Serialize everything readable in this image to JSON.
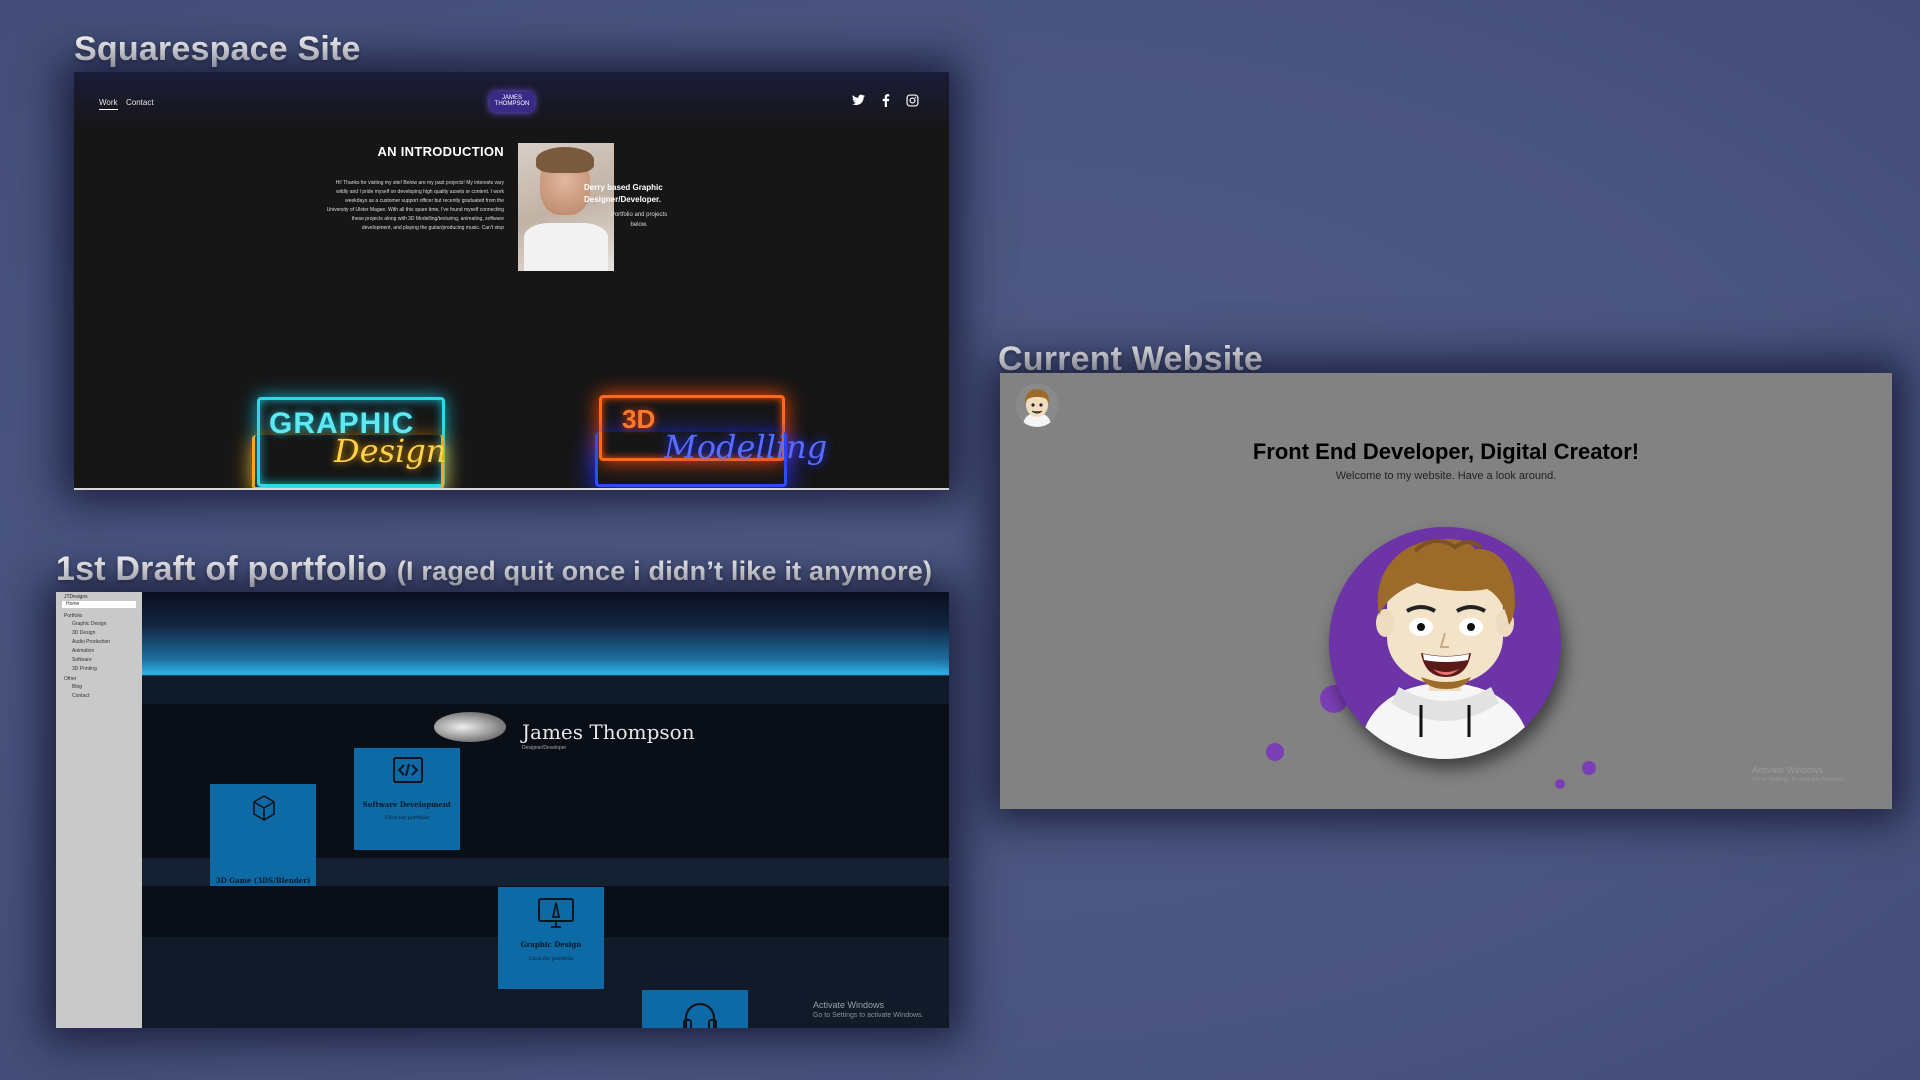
{
  "captions": {
    "squarespace": "Squarespace Site",
    "draft_main": "1st Draft of portfolio",
    "draft_note": "(I raged quit once i didn’t  like it anymore)",
    "current": "Current Website"
  },
  "squarespace": {
    "nav": {
      "work": "Work",
      "contact": "Contact",
      "logo": "JAMES THOMPSON"
    },
    "social": {
      "twitter": "twitter-icon",
      "facebook": "facebook-icon",
      "instagram": "instagram-icon"
    },
    "intro_title": "AN INTRODUCTION",
    "intro_body": "Hi! Thanks for visiting my site! Below are my past projects! My interests vary wildly and I pride myself on developing high quality assets or content. I work weekdays as a customer support officer but recently graduated from the University of Ulster Magee. With all this spare time, I've found myself connecting these projects along with 3D Modelling/texturing, animating, software development, and playing the guitar/producing music. Can't stop",
    "tagline": "Derry based Graphic Designer/Developer.",
    "tagline_sub": "Portfolio and projects below.",
    "neon1_top": "GRAPHIC",
    "neon1_bottom": "Design",
    "neon2_top": "3D",
    "neon2_bottom": "Modelling"
  },
  "draft": {
    "sidebar_title": "JTDesigns",
    "home": "Home",
    "items": [
      {
        "label": "Portfolio"
      },
      {
        "label": "Graphic Design"
      },
      {
        "label": "3D Design"
      },
      {
        "label": "Audio Production"
      },
      {
        "label": "Animation"
      },
      {
        "label": "Software"
      },
      {
        "label": "3D Printing"
      },
      {
        "label": "Other"
      },
      {
        "label": "Blog"
      },
      {
        "label": "Contact"
      }
    ],
    "name": "James Thompson",
    "role": "Designer/Developer",
    "cards": [
      {
        "title": "Software Development",
        "sub": "Click for portfolio",
        "icon": "code-icon"
      },
      {
        "title": "3D Game (3DS/Blender)",
        "sub": "",
        "icon": "cube-icon"
      },
      {
        "title": "Graphic Design",
        "sub": "Click for portfolio",
        "icon": "monitor-icon"
      },
      {
        "title": "",
        "sub": "",
        "icon": "headphones-icon"
      }
    ],
    "watermark": "Activate Windows",
    "watermark_sub": "Go to Settings to activate Windows."
  },
  "current": {
    "headline": "Front End Developer, Digital Creator!",
    "subline": "Welcome to my website. Have a look around.",
    "watermark": "Activate Windows",
    "watermark_sub": "Go to Settings to activate Windows."
  }
}
